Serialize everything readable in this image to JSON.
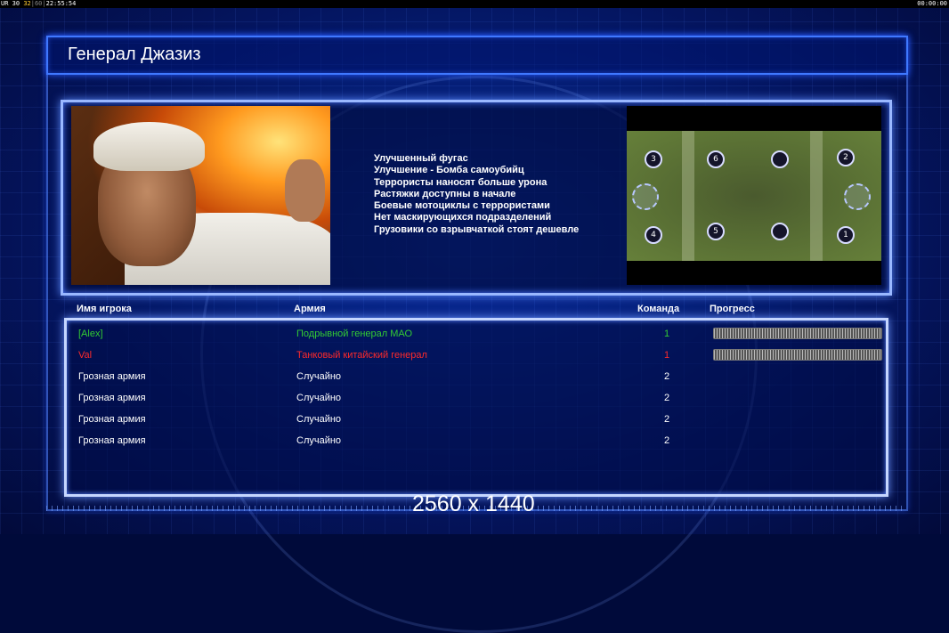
{
  "topbar": {
    "left_label": "UR",
    "left_fps": "30",
    "left_a": "32",
    "left_b": "60",
    "left_time": "22:55:54",
    "right_time": "00:00:00"
  },
  "screen": {
    "title": "Генерал Джазиз",
    "resolution": "2560 x 1440"
  },
  "general_features": [
    "Улучшенный фугас",
    "Улучшение - Бомба самоубийц",
    "Террористы наносят больше урона",
    "Растяжки доступны в начале",
    "Боевые мотоциклы с террористами",
    "Нет маскирующихся подразделений",
    "Грузовики со взрывчаткой стоят дешевле"
  ],
  "map": {
    "spots": [
      "3",
      "6",
      "",
      "2",
      "4",
      "5",
      "",
      "1"
    ]
  },
  "table": {
    "headers": {
      "player": "Имя игрока",
      "army": "Армия",
      "team": "Команда",
      "progress": "Прогресс"
    },
    "rows": [
      {
        "player": "[Alex]",
        "army": "Подрывной генерал МАО",
        "team": "1",
        "color": "#33cc33",
        "progress": 1
      },
      {
        "player": "Val",
        "army": "Танковый китайский генерал",
        "team": "1",
        "color": "#ff2a2a",
        "progress": 1
      },
      {
        "player": "Грозная армия",
        "army": "Случайно",
        "team": "2",
        "color": "#ffffff"
      },
      {
        "player": "Грозная армия",
        "army": "Случайно",
        "team": "2",
        "color": "#ffffff"
      },
      {
        "player": "Грозная армия",
        "army": "Случайно",
        "team": "2",
        "color": "#ffffff"
      },
      {
        "player": "Грозная армия",
        "army": "Случайно",
        "team": "2",
        "color": "#ffffff"
      }
    ]
  }
}
